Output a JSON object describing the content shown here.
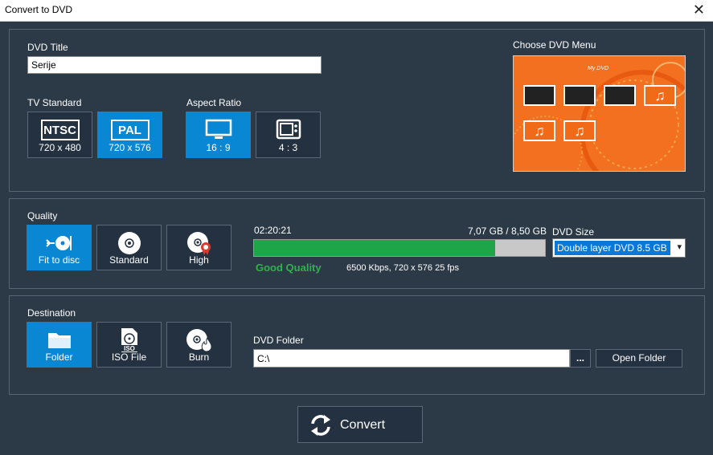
{
  "window": {
    "title": "Convert to DVD",
    "close_glyph": "✕"
  },
  "dvd_title": {
    "label": "DVD Title",
    "value": "Serije"
  },
  "tv_standard": {
    "label": "TV Standard",
    "options": [
      {
        "name": "NTSC",
        "res": "720 x 480",
        "selected": false
      },
      {
        "name": "PAL",
        "res": "720 x 576",
        "selected": true
      }
    ]
  },
  "aspect_ratio": {
    "label": "Aspect Ratio",
    "options": [
      {
        "label": "16 : 9",
        "icon": "widescreen-tv-icon",
        "selected": true
      },
      {
        "label": "4 : 3",
        "icon": "standard-tv-icon",
        "selected": false
      }
    ]
  },
  "menu": {
    "label": "Choose DVD Menu",
    "preview_title": "My DVD"
  },
  "quality": {
    "label": "Quality",
    "options": [
      {
        "label": "Fit to disc",
        "icon": "fit-to-disc-icon",
        "selected": true
      },
      {
        "label": "Standard",
        "icon": "disc-icon",
        "selected": false
      },
      {
        "label": "High",
        "icon": "high-quality-disc-icon",
        "selected": false
      }
    ],
    "duration": "02:20:21",
    "size_text": "7,07 GB / 8,50 GB",
    "fill_fraction": 0.83,
    "status": "Good Quality",
    "details": "6500 Kbps, 720 x 576  25 fps"
  },
  "dvd_size": {
    "label": "DVD Size",
    "selected": "Double layer DVD 8.5 GB",
    "arrow": "▾"
  },
  "destination": {
    "label": "Destination",
    "options": [
      {
        "label": "Folder",
        "icon": "folder-icon",
        "selected": true
      },
      {
        "label": "ISO File",
        "icon": "iso-file-icon",
        "selected": false
      },
      {
        "label": "Burn",
        "icon": "burn-disc-icon",
        "selected": false
      }
    ],
    "folder_label": "DVD Folder",
    "folder_value": "C:\\",
    "browse_label": "...",
    "open_folder_label": "Open Folder"
  },
  "convert": {
    "label": "Convert"
  },
  "colors": {
    "accent": "#0a87d2",
    "progress": "#1ea548",
    "good_quality": "#2eb34a",
    "menu_bg": "#f2701f"
  }
}
